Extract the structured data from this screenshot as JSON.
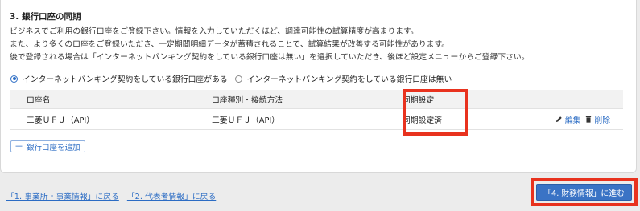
{
  "section": {
    "title": "3. 銀行口座の同期",
    "description": [
      "ビジネスでご利用の銀行口座をご登録下さい。情報を入力していただくほど、調達可能性の試算精度が高まります。",
      "また、より多くの口座をご登録いただき、一定期間明細データが蓄積されることで、試算結果が改善する可能性があります。",
      "後で登録される場合は「インターネットバンキング契約をしている銀行口座は無い」を選択していただき、後ほど設定メニューからご登録下さい。"
    ]
  },
  "radio_options": [
    {
      "label": "インターネットバンキング契約をしている銀行口座がある",
      "checked": true
    },
    {
      "label": "インターネットバンキング契約をしている銀行口座は無い",
      "checked": false
    }
  ],
  "table": {
    "headers": [
      "口座名",
      "口座種別・接続方法",
      "同期設定"
    ],
    "rows": [
      {
        "account_name": "三菱ＵＦＪ（API）",
        "account_type": "三菱ＵＦＪ（API）",
        "sync_status": "同期設定済",
        "edit_label": "編集",
        "delete_label": "削除"
      }
    ]
  },
  "add_account_label": "銀行口座を追加",
  "nav": {
    "back_links": [
      "「1. 事業所・事業情報」に戻る",
      "「2. 代表者情報」に戻る"
    ],
    "next_label": "「4. 財務情報」に進む"
  },
  "colors": {
    "accent": "#2b6cc4",
    "primary_button": "#3a73c5",
    "highlight": "#e8321e"
  },
  "icons": {
    "edit": "pencil-icon",
    "delete": "trash-icon",
    "add": "plus-icon"
  }
}
